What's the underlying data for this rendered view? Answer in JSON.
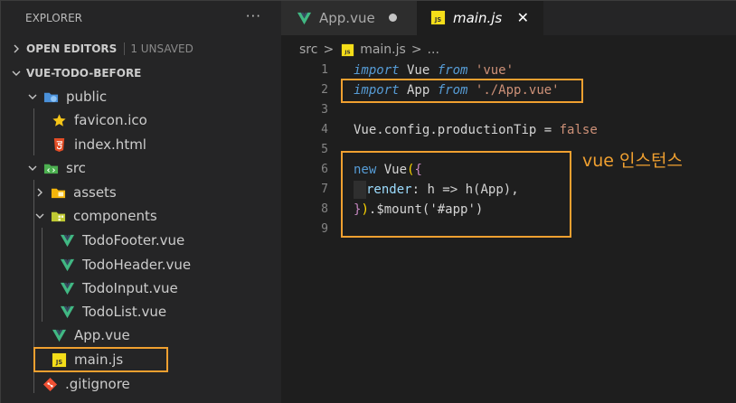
{
  "sidebar": {
    "title": "EXPLORER",
    "more": "···",
    "open_editors": {
      "label": "OPEN EDITORS",
      "unsaved": "1 UNSAVED"
    },
    "project": {
      "label": "VUE-TODO-BEFORE"
    },
    "tree": {
      "public": "public",
      "favicon": "favicon.ico",
      "index": "index.html",
      "src": "src",
      "assets": "assets",
      "components": "components",
      "todo_footer": "TodoFooter.vue",
      "todo_header": "TodoHeader.vue",
      "todo_input": "TodoInput.vue",
      "todo_list": "TodoList.vue",
      "app_vue": "App.vue",
      "main_js": "main.js",
      "gitignore": ".gitignore"
    }
  },
  "tabs": {
    "inactive": {
      "label": "App.vue"
    },
    "active": {
      "label": "main.js",
      "icon_text": "JS"
    }
  },
  "breadcrumb": {
    "folder": "src",
    "file": "main.js",
    "sep": ">",
    "ellipsis": "..."
  },
  "editor": {
    "line_numbers": [
      "1",
      "2",
      "3",
      "4",
      "5",
      "6",
      "7",
      "8",
      "9"
    ],
    "code": {
      "l1": {
        "kw1": "import",
        "id": " Vue ",
        "kw2": "from",
        "sp": " ",
        "str": "'vue'"
      },
      "l2": {
        "kw1": "import",
        "id": " App ",
        "kw2": "from",
        "sp": " ",
        "str": "'./App.vue'"
      },
      "l4": {
        "id1": "Vue",
        "dot1": ".",
        "id2": "config",
        "dot2": ".",
        "id3": "productionTip",
        "op": " = ",
        "val": "false"
      },
      "l6": {
        "kw": "new",
        "sp": " ",
        "cls": "Vue",
        "paren": "(",
        "brace": "{"
      },
      "l7": {
        "prop": "render",
        "colon": ": ",
        "arg": "h",
        "arrow": " => ",
        "fn": "h",
        "open": "(",
        "arg2": "App",
        "close": ")",
        "comma": ","
      },
      "l8": {
        "brace": "}",
        "paren": ")",
        "dot": ".",
        "fn": "$mount",
        "open": "(",
        "str": "'#app'",
        "close": ")"
      }
    },
    "annotation": "vue 인스턴스"
  },
  "colors": {
    "highlight": "#f0a030",
    "vue_green": "#41b883",
    "js_yellow": "#f5de19"
  }
}
